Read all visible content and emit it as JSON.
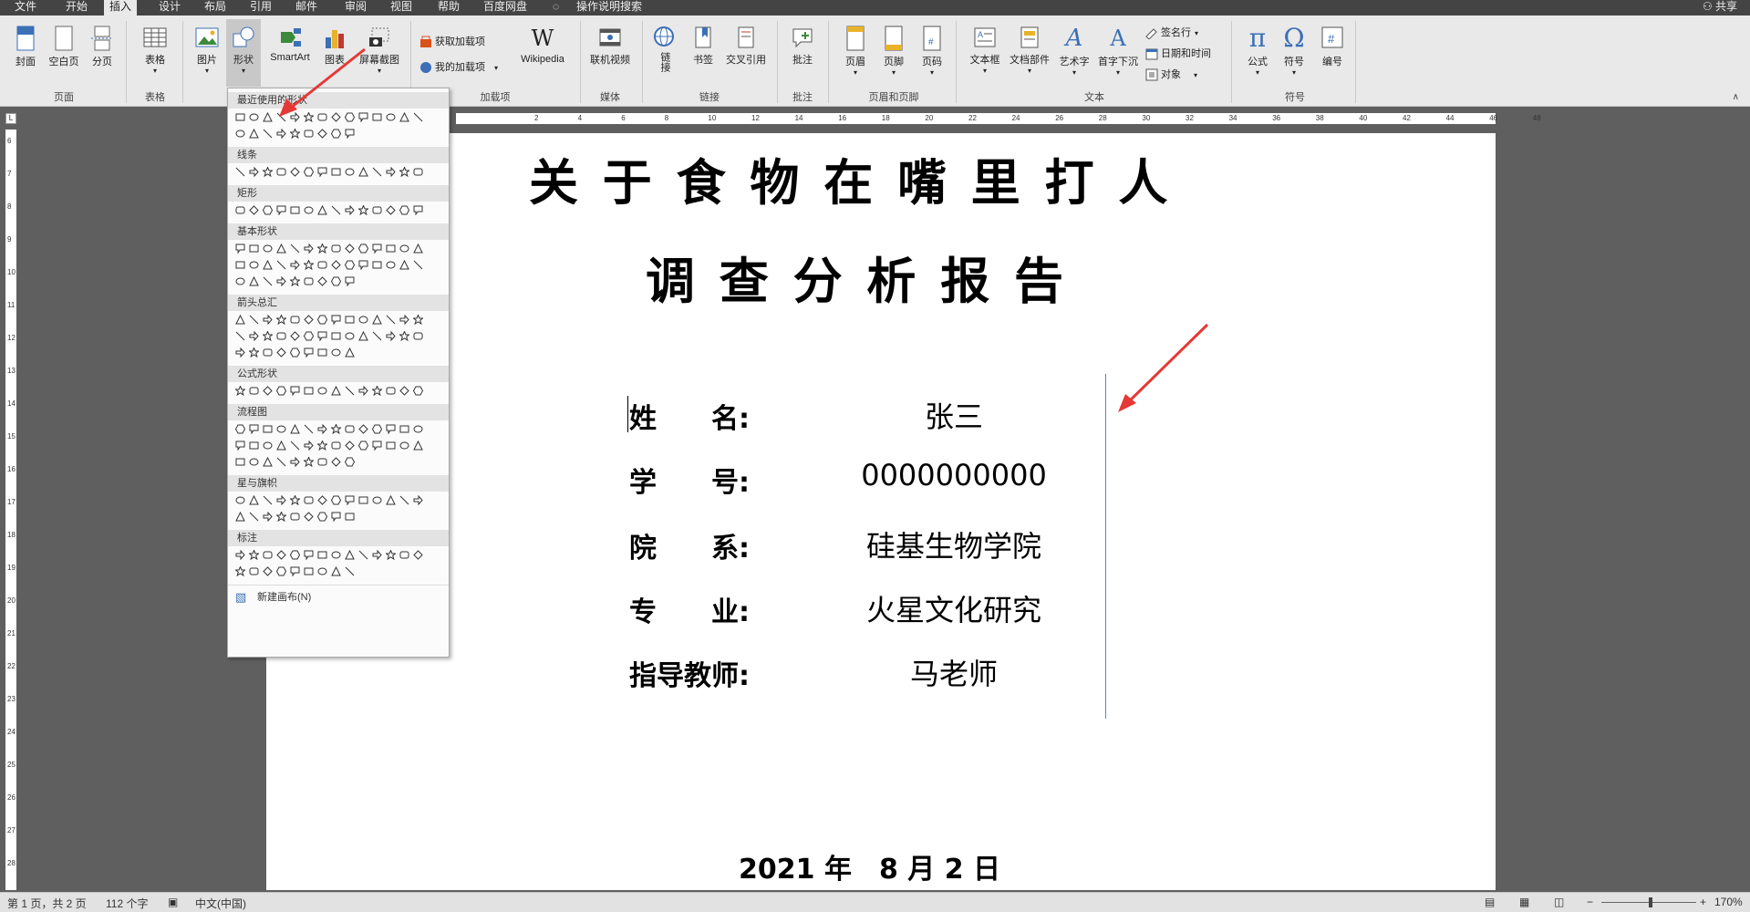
{
  "tabs": [
    "文件",
    "开始",
    "插入",
    "设计",
    "布局",
    "引用",
    "邮件",
    "审阅",
    "视图",
    "帮助",
    "百度网盘",
    "操作说明搜索"
  ],
  "active_tab": "插入",
  "share_label": "共享",
  "ribbon": {
    "pages": {
      "cover": "封面",
      "blank": "空白页",
      "break": "分页",
      "group": "页面"
    },
    "tables": {
      "table": "表格",
      "group": "表格"
    },
    "illustrations": {
      "picture": "图片",
      "shapes": "形状",
      "smartart": "SmartArt",
      "chart": "图表",
      "screenshot": "屏幕截图"
    },
    "addins": {
      "get": "获取加载项",
      "mine": "我的加载项",
      "wikipedia": "Wikipedia",
      "group": "加载项"
    },
    "media": {
      "online_video": "联机视频",
      "group": "媒体"
    },
    "links": {
      "link": "链接",
      "bookmark": "书签",
      "crossref": "交叉引用",
      "group": "链接"
    },
    "comments": {
      "comment": "批注",
      "group": "批注"
    },
    "headerfooter": {
      "header": "页眉",
      "footer": "页脚",
      "pagenum": "页码",
      "group": "页眉和页脚"
    },
    "text": {
      "textbox": "文本框",
      "quickparts": "文档部件",
      "wordart": "艺术字",
      "dropcap": "首字下沉",
      "sigline": "签名行",
      "datetime": "日期和时间",
      "object": "对象",
      "group": "文本"
    },
    "symbols": {
      "equation": "公式",
      "symbol": "符号",
      "number": "编号",
      "group": "符号"
    }
  },
  "shapes_menu": {
    "categories": [
      "最近使用的形状",
      "线条",
      "矩形",
      "基本形状",
      "箭头总汇",
      "公式形状",
      "流程图",
      "星与旗帜",
      "标注"
    ],
    "new_canvas": "新建画布(N)"
  },
  "hruler_ticks": [
    "2",
    "4",
    "6",
    "8",
    "10",
    "12",
    "14",
    "16",
    "18",
    "20",
    "22",
    "24",
    "26",
    "28",
    "30",
    "32",
    "34",
    "36",
    "38",
    "40",
    "42",
    "44",
    "46",
    "48"
  ],
  "vruler_ticks": [
    "6",
    "7",
    "8",
    "9",
    "10",
    "11",
    "12",
    "13",
    "14",
    "15",
    "16",
    "17",
    "18",
    "19",
    "20",
    "21",
    "22",
    "23",
    "24",
    "25",
    "26",
    "27",
    "28"
  ],
  "document": {
    "title_line1": "关 于 食 物 在 嘴 里 打 人",
    "title_line2": "调 查 分 析 报 告",
    "fields": [
      {
        "label": "姓　　名:",
        "value": "张三"
      },
      {
        "label": "学　　号:",
        "value": "0000000000"
      },
      {
        "label": "院　　系:",
        "value": "硅基生物学院"
      },
      {
        "label": "专　　业:",
        "value": "火星文化研究"
      },
      {
        "label": "指导教师:",
        "value": "马老师"
      }
    ],
    "date": "2021 年　8  月  2  日"
  },
  "status": {
    "page": "第 1 页，共 2 页",
    "words": "112 个字",
    "language": "中文(中国)",
    "zoom": "170%"
  }
}
